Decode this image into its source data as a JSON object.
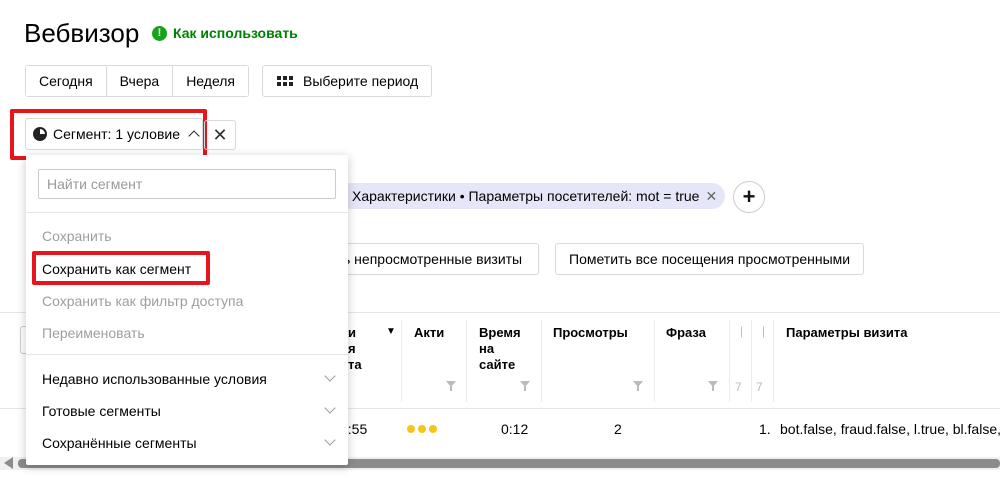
{
  "header": {
    "title": "Вебвизор",
    "howto_label": "Как использовать"
  },
  "period": {
    "options": [
      "Сегодня",
      "Вчера",
      "Неделя"
    ],
    "custom_label": "Выберите период"
  },
  "segment": {
    "button_label": "Сегмент: 1 условие"
  },
  "filter_chip": {
    "label": "Характеристики • Параметры посетителей: mot = true"
  },
  "actions": {
    "mark_unviewed_partial": "ь непросмотренные визиты",
    "mark_all_viewed": "Пометить все посещения просмотренными"
  },
  "dropdown": {
    "search_placeholder": "Найти сегмент",
    "items": {
      "save": "Сохранить",
      "save_as_segment": "Сохранить как сегмент",
      "save_as_filter": "Сохранить как фильтр доступа",
      "rename": "Переименовать"
    },
    "groups": [
      "Недавно использованные условия",
      "Готовые сегменты",
      "Сохранённые сегменты"
    ]
  },
  "table": {
    "headers": {
      "date_partial": [
        "и",
        "я",
        "та"
      ],
      "activity": "Акти",
      "time_on_site": [
        "Время",
        "на",
        "сайте"
      ],
      "views": "Просмотры",
      "phrase": "Фраза",
      "visit_params": "Параметры визита"
    },
    "row": {
      "time_partial": "7:55",
      "duration": "0:12",
      "views": "2",
      "index": "1.",
      "params": "bot.false, fraud.false, l.true, bl.false,"
    }
  },
  "colors": {
    "accent_green": "#1aa31a",
    "highlight_red": "#e8141b",
    "chip_bg": "#e6e6f9",
    "activity_dot": "#f5c518"
  }
}
